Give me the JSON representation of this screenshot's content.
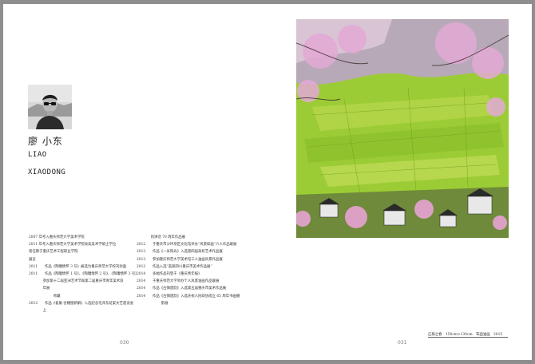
{
  "artist": {
    "name_cn": "廖 小东",
    "name_en_line1": "LIAO",
    "name_en_line2": "XIAODONG"
  },
  "bio_left": [
    "2007 年考入重庆师范大学美术学院",
    "2011 年考入重庆师范大学美术学院攻读美术学硕士学位",
    "现任教于重庆艺术工程职业学院",
    "展览",
    "2011　　作品《陶罐情怀 3 号》被选为重庆师范大学校刊封面",
    "2011　　作品《陶罐情怀 1 号》、《陶罐情怀 2 号》、《陶罐情怀 3 号》",
    "　　　　参加第十二届亚洲艺术节既第二届重庆市青年美术双",
    "　　　　年展",
    "　　　　　　　师藏",
    "2012　　作品《雀巢·谷穗图新解》入选纪念毛泽东延安文艺座谈会",
    "　　　　上"
  ],
  "bio_right": [
    "　　　　的讲话 70 周年作品展",
    "2012　　于重庆市沙坪坝区文化馆举办“风景如画”六人作品联展",
    "2013　　作品《一米阳光》入选第四届高校艺术作品展",
    "2013　　参加重庆师范大学美术馆三人油画风景作品展",
    "2013　　作品入选“美丽四川重庆市美术作品展”",
    "2014　　多幅作品刊登于《重庆青年报》",
    "2014　　于重庆师范大学举办个人风景油画作品联展",
    "2014　　作品《古镇遗韵》入选第五届重庆市美术作品展",
    "2014　　作品《古镇遗韵》入选庆祝人民政协成立 65 周年书画摄",
    "　　　　　　　影展"
  ],
  "page_numbers": {
    "left": "030",
    "right": "031"
  },
  "caption": "庄稼之春　150cm×130cm　布面油画　2015"
}
